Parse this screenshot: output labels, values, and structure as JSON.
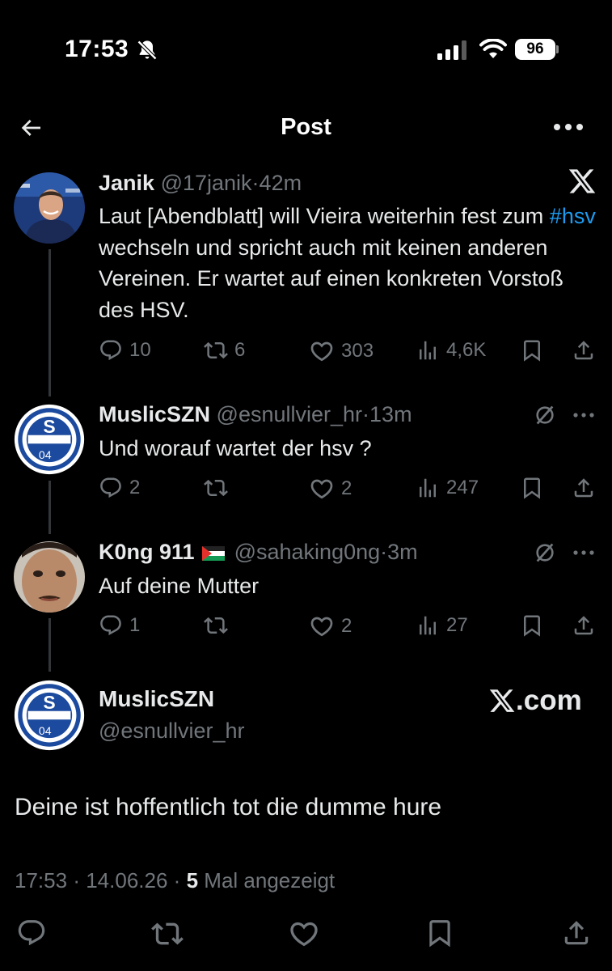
{
  "status_bar": {
    "time": "17:53",
    "battery": "96"
  },
  "header": {
    "title": "Post"
  },
  "tweets": [
    {
      "name": "Janik",
      "handle": "@17janik",
      "time": "42m",
      "text_parts": [
        "Laut [Abendblatt] will Vieira weiterhin fest zum ",
        "#hsv",
        " wechseln und spricht auch mit keinen anderen Vereinen. Er wartet auf einen konkreten Vorstoß des HSV."
      ],
      "replies": "10",
      "reposts": "6",
      "likes": "303",
      "views": "4,6K"
    },
    {
      "name": "MuslicSZN",
      "handle": "@esnullvier_hr",
      "time": "13m",
      "text": "Und worauf wartet der hsv ?",
      "replies": "2",
      "reposts": "",
      "likes": "2",
      "views": "247"
    },
    {
      "name": "K0ng 911",
      "handle": "@sahaking0ng",
      "time": "3m",
      "text": "Auf deine Mutter",
      "replies": "1",
      "reposts": "",
      "likes": "2",
      "views": "27"
    }
  ],
  "main_post": {
    "name": "MuslicSZN",
    "handle": "@esnullvier_hr",
    "watermark": ".com",
    "text": "Deine ist hoffentlich tot die dumme hure",
    "time": "17:53",
    "date": "14.06.26",
    "views_count": "5",
    "views_label": "Mal angezeigt"
  },
  "separator": "·",
  "colors": {
    "background": "#000000",
    "text": "#e7e9ea",
    "muted": "#71767b",
    "link": "#1d9bf0",
    "schalke_blue": "#1c4a9e"
  }
}
